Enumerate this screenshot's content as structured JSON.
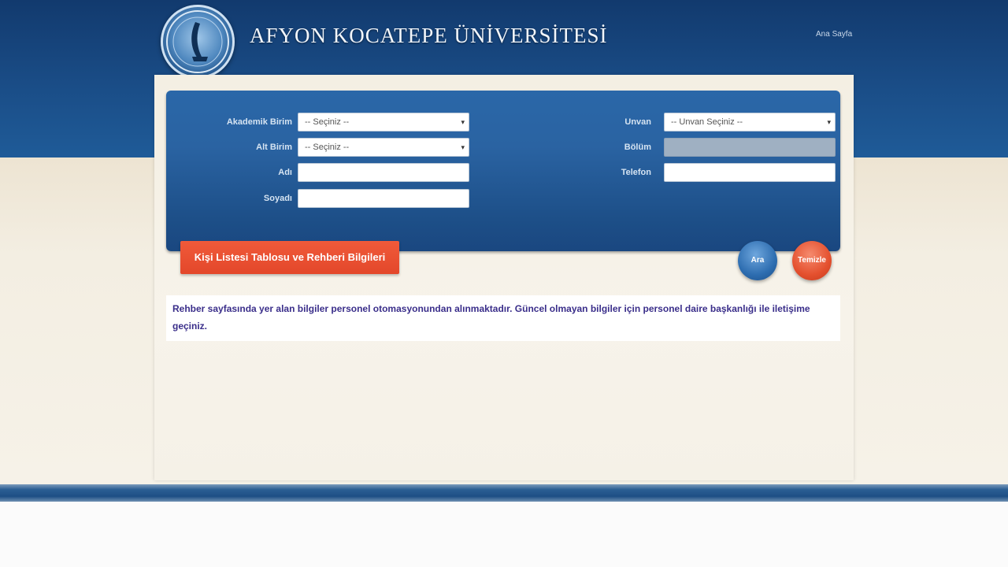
{
  "header": {
    "logo_text": "AFYON KOCATEPE ÜNİVERSİTESİ",
    "top_link": "Ana Sayfa"
  },
  "form": {
    "left": [
      {
        "label": "Akademik Birim",
        "type": "select",
        "value": "-- Seçiniz --"
      },
      {
        "label": "Alt Birim",
        "type": "select",
        "value": "-- Seçiniz --"
      },
      {
        "label": "Adı",
        "type": "text",
        "value": ""
      },
      {
        "label": "Soyadı",
        "type": "text",
        "value": ""
      }
    ],
    "right": [
      {
        "label": "Unvan",
        "type": "select",
        "value": "-- Unvan Seçiniz --"
      },
      {
        "label": "Bölüm",
        "type": "select",
        "value": "",
        "disabled": true
      },
      {
        "label": "Telefon",
        "type": "text",
        "value": ""
      }
    ]
  },
  "actions": {
    "primary_label": "Kişi Listesi Tablosu ve Rehberi Bilgileri",
    "search_label": "Ara",
    "clear_label": "Temizle"
  },
  "notice": {
    "text": "Rehber sayfasında yer alan bilgiler personel otomasyonundan alınmaktadır. Güncel olmayan bilgiler için personel daire başkanlığı ile iletişime geçiniz."
  },
  "colors": {
    "header_blue": "#1a4d87",
    "form_panel_blue": "#2a63a2",
    "accent_red": "#e3472a",
    "notice_text": "#3a2e8a"
  }
}
